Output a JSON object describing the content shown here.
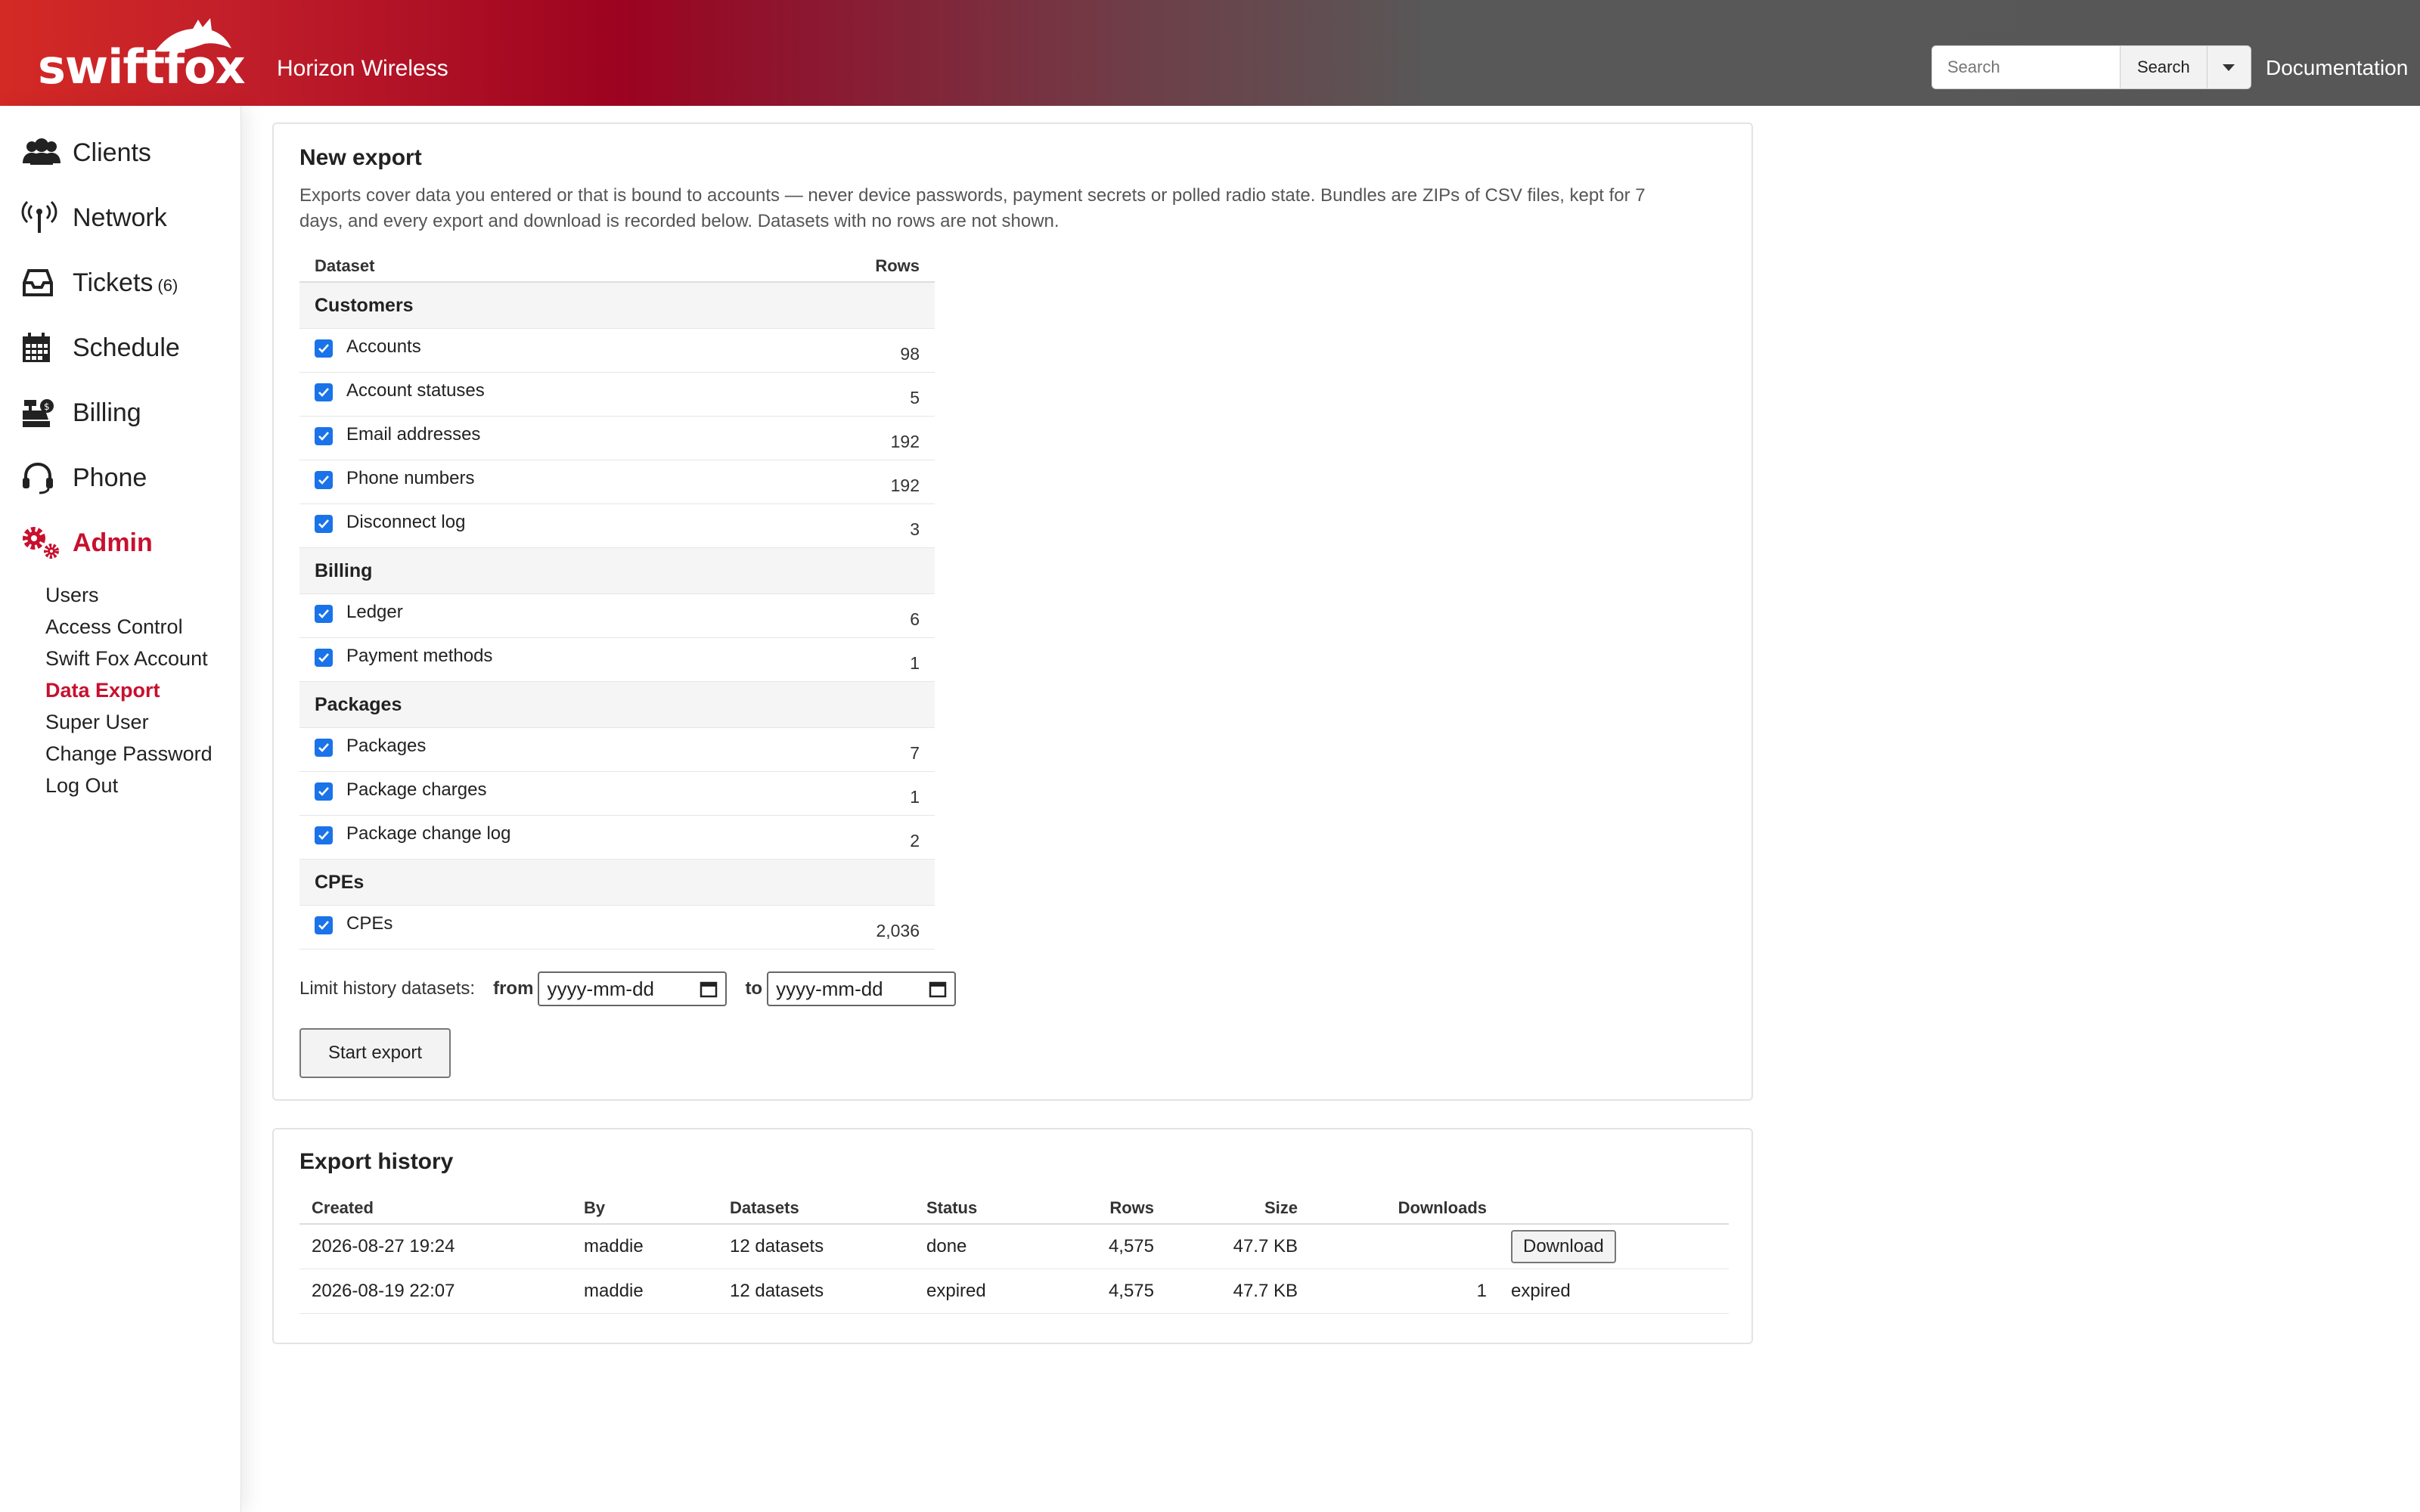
{
  "header": {
    "logo_text": "swiftfox",
    "company": "Horizon Wireless",
    "search_placeholder": "Search",
    "search_button": "Search",
    "documentation": "Documentation"
  },
  "sidebar": {
    "items": [
      {
        "label": "Clients",
        "icon": "users-icon"
      },
      {
        "label": "Network",
        "icon": "antenna-icon"
      },
      {
        "label": "Tickets",
        "badge": "(6)",
        "icon": "inbox-icon"
      },
      {
        "label": "Schedule",
        "icon": "calendar-icon"
      },
      {
        "label": "Billing",
        "icon": "cash-register-icon"
      },
      {
        "label": "Phone",
        "icon": "headset-icon"
      },
      {
        "label": "Admin",
        "icon": "gears-icon",
        "active": true
      }
    ],
    "admin_subitems": [
      "Users",
      "Access Control",
      "Swift Fox Account",
      "Data Export",
      "Super User",
      "Change Password",
      "Log Out"
    ],
    "active_subitem": "Data Export"
  },
  "new_export": {
    "title": "New export",
    "intro": "Exports cover data you entered or that is bound to accounts — never device passwords, payment secrets or polled radio state. Bundles are ZIPs of CSV files, kept for 7 days, and every export and download is recorded below. Datasets with no rows are not shown.",
    "col_dataset": "Dataset",
    "col_rows": "Rows",
    "groups": [
      {
        "name": "Customers",
        "datasets": [
          {
            "name": "Accounts",
            "rows": "98",
            "checked": true
          },
          {
            "name": "Account statuses",
            "rows": "5",
            "checked": true
          },
          {
            "name": "Email addresses",
            "rows": "192",
            "checked": true
          },
          {
            "name": "Phone numbers",
            "rows": "192",
            "checked": true
          },
          {
            "name": "Disconnect log",
            "rows": "3",
            "checked": true
          }
        ]
      },
      {
        "name": "Billing",
        "datasets": [
          {
            "name": "Ledger",
            "rows": "6",
            "checked": true
          },
          {
            "name": "Payment methods",
            "rows": "1",
            "checked": true
          }
        ]
      },
      {
        "name": "Packages",
        "datasets": [
          {
            "name": "Packages",
            "rows": "7",
            "checked": true
          },
          {
            "name": "Package charges",
            "rows": "1",
            "checked": true
          },
          {
            "name": "Package change log",
            "rows": "2",
            "checked": true
          }
        ]
      },
      {
        "name": "CPEs",
        "datasets": [
          {
            "name": "CPEs",
            "rows": "2,036",
            "checked": true
          }
        ]
      }
    ],
    "limit_label": "Limit history datasets:",
    "from_label": "from",
    "to_label": "to",
    "from_placeholder": "yyyy-mm-dd",
    "to_placeholder": "yyyy-mm-dd",
    "start_button": "Start export"
  },
  "history": {
    "title": "Export history",
    "columns": [
      "Created",
      "By",
      "Datasets",
      "Status",
      "Rows",
      "Size",
      "Downloads"
    ],
    "rows": [
      {
        "created": "2026-08-27 19:24",
        "by": "maddie",
        "datasets": "12 datasets",
        "status": "done",
        "rows": "4,575",
        "size": "47.7 KB",
        "downloads": "",
        "action": "Download"
      },
      {
        "created": "2026-08-19 22:07",
        "by": "maddie",
        "datasets": "12 datasets",
        "status": "expired",
        "rows": "4,575",
        "size": "47.7 KB",
        "downloads": "1",
        "action": "expired"
      }
    ]
  },
  "colors": {
    "accent": "#c8102e",
    "checkbox": "#1a73e8",
    "done": "#2e7d32"
  }
}
